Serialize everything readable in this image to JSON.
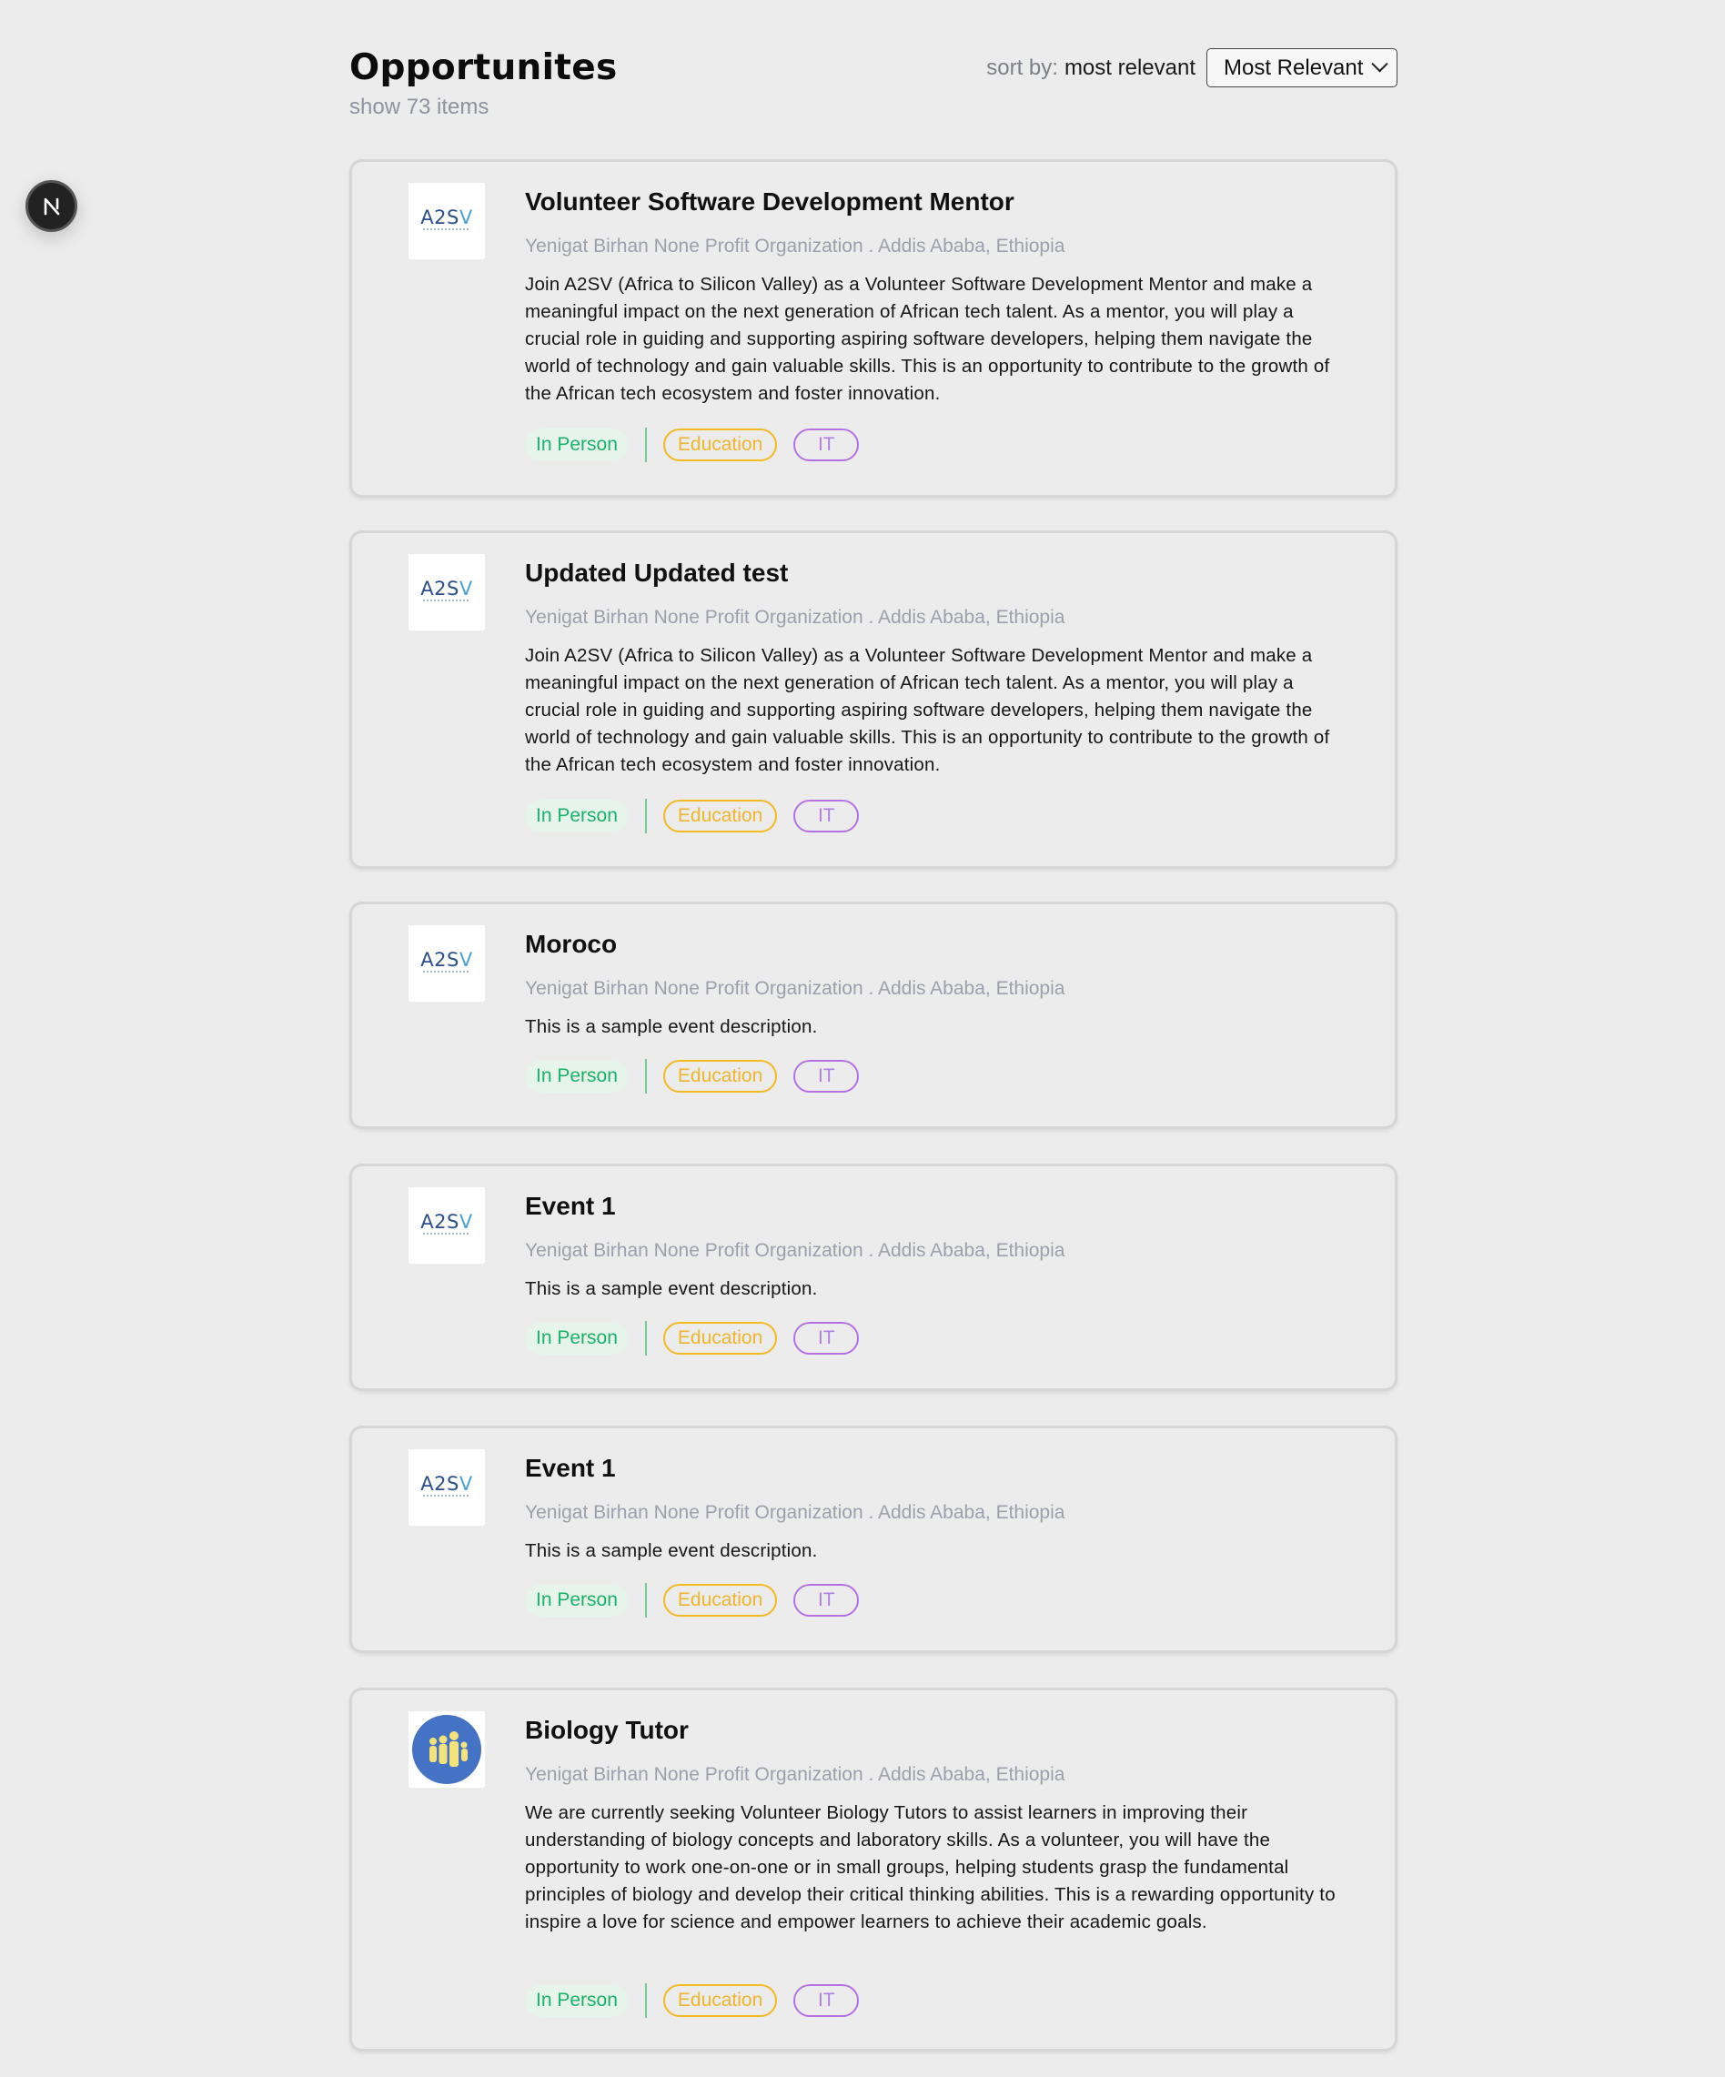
{
  "header": {
    "title": "Opportunites",
    "count_text": "show 73 items",
    "sort_label": "sort by:",
    "sort_current": "most relevant",
    "sort_select_value": "Most Relevant"
  },
  "nav_badge": {
    "letter": "N"
  },
  "cards": [
    {
      "title": "Volunteer Software Development Mentor",
      "org": "Yenigat Birhan None Profit Organization . Addis Ababa, Ethiopia",
      "description": "Join A2SV (Africa to Silicon Valley) as a Volunteer Software Development Mentor and make a meaningful impact on the next generation of African tech talent. As a mentor, you will play a crucial role in guiding and supporting aspiring software developers, helping them navigate the world of technology and gain valuable skills. This is an opportunity to contribute to the growth of the African tech ecosystem and foster innovation.",
      "logo": "A2SV",
      "tags": [
        "In Person",
        "Education",
        "IT"
      ]
    },
    {
      "title": "Updated Updated test",
      "org": "Yenigat Birhan None Profit Organization . Addis Ababa, Ethiopia",
      "description": "Join A2SV (Africa to Silicon Valley) as a Volunteer Software Development Mentor and make a meaningful impact on the next generation of African tech talent. As a mentor, you will play a crucial role in guiding and supporting aspiring software developers, helping them navigate the world of technology and gain valuable skills. This is an opportunity to contribute to the growth of the African tech ecosystem and foster innovation.",
      "logo": "A2SV",
      "tags": [
        "In Person",
        "Education",
        "IT"
      ]
    },
    {
      "title": "Moroco",
      "org": "Yenigat Birhan None Profit Organization . Addis Ababa, Ethiopia",
      "description": "This is a sample event description.",
      "logo": "A2SV",
      "tags": [
        "In Person",
        "Education",
        "IT"
      ]
    },
    {
      "title": "Event 1",
      "org": "Yenigat Birhan None Profit Organization . Addis Ababa, Ethiopia",
      "description": "This is a sample event description.",
      "logo": "A2SV",
      "tags": [
        "In Person",
        "Education",
        "IT"
      ]
    },
    {
      "title": "Event 1",
      "org": "Yenigat Birhan None Profit Organization . Addis Ababa, Ethiopia",
      "description": "This is a sample event description.",
      "logo": "A2SV",
      "tags": [
        "In Person",
        "Education",
        "IT"
      ]
    },
    {
      "title": "Biology Tutor",
      "org": "Yenigat Birhan None Profit Organization . Addis Ababa, Ethiopia",
      "description": "We are currently seeking Volunteer Biology Tutors to assist learners in improving their understanding of biology concepts and laboratory skills. As a volunteer, you will have the opportunity to work one-on-one or in small groups, helping students grasp the fundamental principles of biology and develop their critical thinking abilities. This is a rewarding opportunity to inspire a love for science and empower learners to achieve their academic goals.",
      "logo": "family-icon",
      "tags": [
        "In Person",
        "Education",
        "IT"
      ]
    }
  ],
  "colors": {
    "in_person": "#1bb26b",
    "education": "#f5b921",
    "it": "#b570e8",
    "org_text": "#9aa0ad"
  }
}
